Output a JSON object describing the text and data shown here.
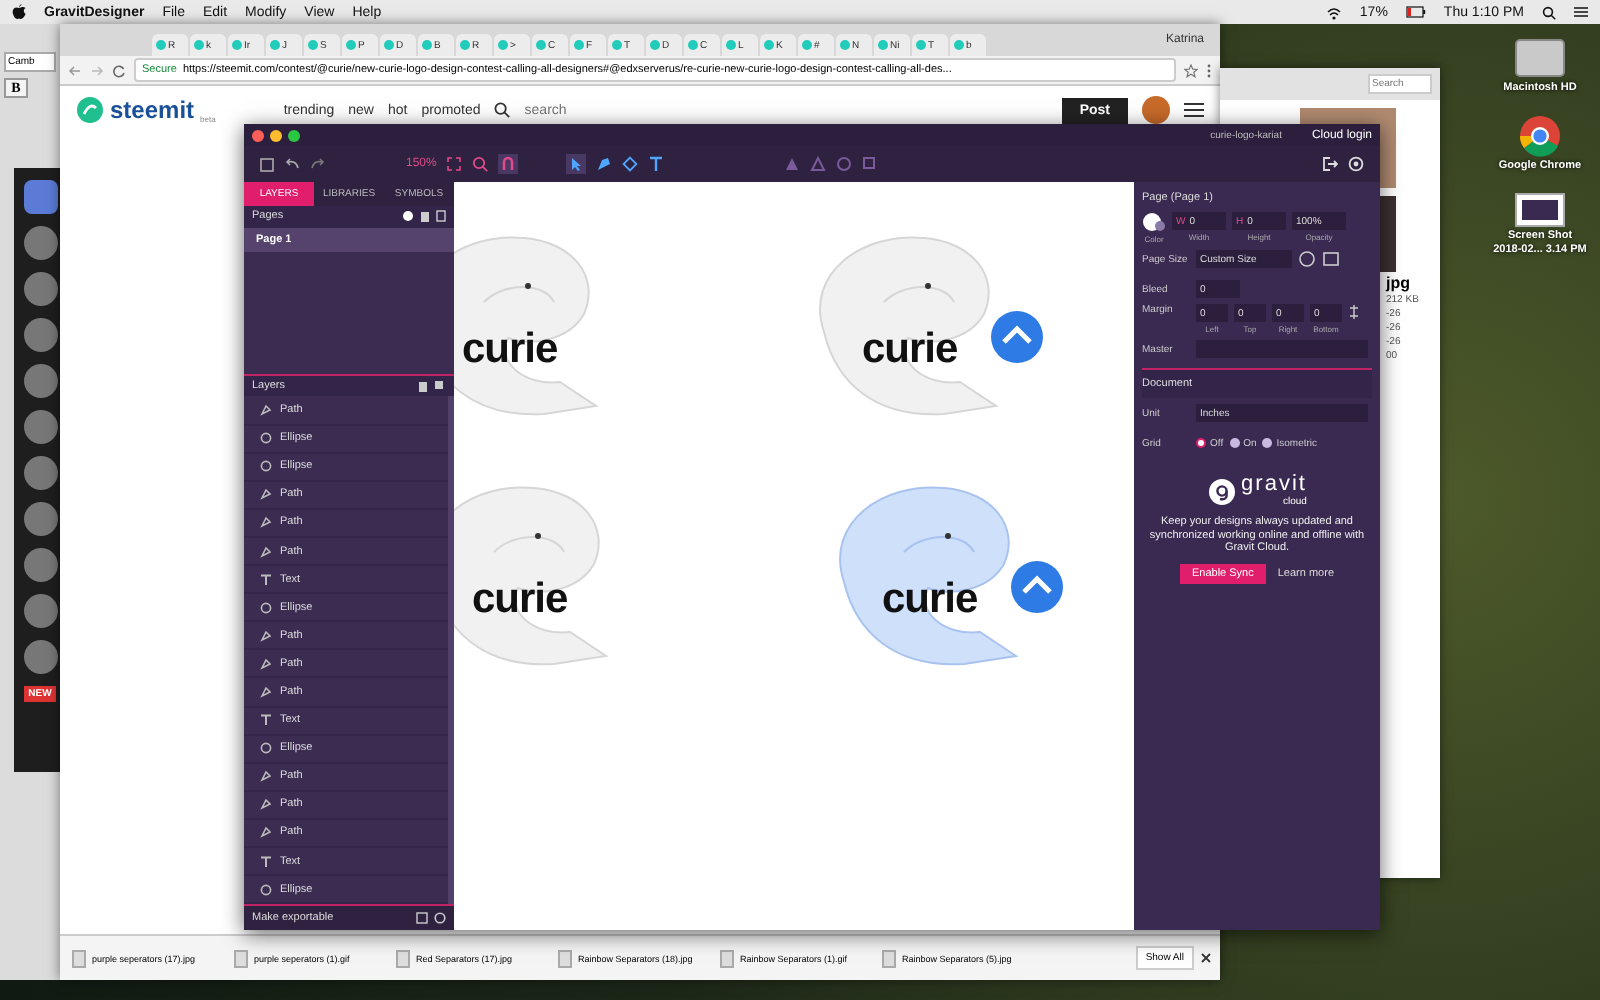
{
  "menubar": {
    "app": "GravitDesigner",
    "menus": [
      "File",
      "Edit",
      "Modify",
      "View",
      "Help"
    ],
    "battery": "17%",
    "clock": "Thu 1:10 PM"
  },
  "left_window": {
    "bold_button": "B",
    "font_field": "Camb"
  },
  "dock": {
    "new_badge": "NEW"
  },
  "browser": {
    "tabs": [
      {
        "label": "R"
      },
      {
        "label": "k"
      },
      {
        "label": "Ir"
      },
      {
        "label": "J"
      },
      {
        "label": "S"
      },
      {
        "label": "P"
      },
      {
        "label": "D"
      },
      {
        "label": "B"
      },
      {
        "label": "R"
      },
      {
        "label": ">"
      },
      {
        "label": "C"
      },
      {
        "label": "F"
      },
      {
        "label": "T"
      },
      {
        "label": "D"
      },
      {
        "label": "C"
      },
      {
        "label": "L"
      },
      {
        "label": "K"
      },
      {
        "label": "#"
      },
      {
        "label": "N"
      },
      {
        "label": "Ni"
      },
      {
        "label": "T"
      },
      {
        "label": "b"
      }
    ],
    "profile": "Katrina",
    "secure": "Secure",
    "url": "https://steemit.com/contest/@curie/new-curie-logo-design-contest-calling-all-designers#@edxserverus/re-curie-new-curie-logo-design-contest-calling-all-des...",
    "site": {
      "logo": "steemit",
      "tagline": "beta",
      "nav": [
        "trending",
        "new",
        "hot",
        "promoted"
      ],
      "search_placeholder": "search",
      "post": "Post"
    },
    "downloads": [
      "purple seperators (17).jpg",
      "purple seperators (1).gif",
      "Red Separators (17).jpg",
      "Rainbow Separators (18).jpg",
      "Rainbow Separators (1).gif",
      "Rainbow Separators (5).jpg"
    ],
    "show_all": "Show All"
  },
  "finder": {
    "search_placeholder": "Search",
    "file_name": "jpg",
    "size": "212 KB",
    "dates": [
      "-26",
      "-26",
      "-26",
      "00"
    ]
  },
  "desktop_icons": [
    {
      "kind": "drive",
      "lines": [
        "Macintosh HD"
      ]
    },
    {
      "kind": "app",
      "lines": [
        "Google Chrome"
      ]
    },
    {
      "kind": "screenshot",
      "lines": [
        "Screen Shot",
        "2018-02... 3.14 PM"
      ]
    }
  ],
  "gravit": {
    "document": "curie-logo-kariat",
    "cloud_login": "Cloud login",
    "zoom": "150%",
    "panel_tabs": [
      {
        "label": "LAYERS",
        "selected": true
      },
      {
        "label": "LIBRARIES",
        "selected": false
      },
      {
        "label": "SYMBOLS",
        "selected": false
      }
    ],
    "pages_label": "Pages",
    "pages": [
      {
        "name": "Page 1",
        "selected": true
      }
    ],
    "layers_label": "Layers",
    "layers": [
      {
        "kind": "path",
        "name": "Path"
      },
      {
        "kind": "ellipse",
        "name": "Ellipse"
      },
      {
        "kind": "ellipse",
        "name": "Ellipse"
      },
      {
        "kind": "path",
        "name": "Path"
      },
      {
        "kind": "path",
        "name": "Path"
      },
      {
        "kind": "path",
        "name": "Path"
      },
      {
        "kind": "text",
        "name": "Text"
      },
      {
        "kind": "ellipse",
        "name": "Ellipse"
      },
      {
        "kind": "path",
        "name": "Path"
      },
      {
        "kind": "path",
        "name": "Path"
      },
      {
        "kind": "path",
        "name": "Path"
      },
      {
        "kind": "text",
        "name": "Text"
      },
      {
        "kind": "ellipse",
        "name": "Ellipse"
      },
      {
        "kind": "path",
        "name": "Path"
      },
      {
        "kind": "path",
        "name": "Path"
      },
      {
        "kind": "path",
        "name": "Path"
      },
      {
        "kind": "text",
        "name": "Text"
      },
      {
        "kind": "ellipse",
        "name": "Ellipse"
      }
    ],
    "footer": "Make exportable",
    "canvas": {
      "logos": [
        {
          "text": "curie",
          "filled": false,
          "badge": false
        },
        {
          "text": "curie",
          "filled": false,
          "badge": true
        },
        {
          "text": "curie",
          "filled": false,
          "badge": false
        },
        {
          "text": "curie",
          "filled": true,
          "badge": true
        }
      ]
    },
    "inspector": {
      "title": "Page (Page 1)",
      "color_label": "Color",
      "size_fields": [
        {
          "prefix": "W",
          "value": "0",
          "label": "Width"
        },
        {
          "prefix": "H",
          "value": "0",
          "label": "Height"
        },
        {
          "value": "100%",
          "label": "Opacity"
        }
      ],
      "page_size": {
        "label": "Page Size",
        "value": "Custom Size"
      },
      "bleed": {
        "label": "Bleed",
        "value": "0"
      },
      "margin": {
        "label": "Margin",
        "fields": [
          {
            "value": "0",
            "label": "Left"
          },
          {
            "value": "0",
            "label": "Top"
          },
          {
            "value": "0",
            "label": "Right"
          },
          {
            "value": "0",
            "label": "Bottom"
          }
        ]
      },
      "master": {
        "label": "Master"
      },
      "document_title": "Document",
      "unit": {
        "label": "Unit",
        "value": "Inches"
      },
      "grid": {
        "label": "Grid",
        "options": [
          {
            "label": "Off",
            "selected": true
          },
          {
            "label": "On",
            "selected": false
          },
          {
            "label": "Isometric",
            "selected": false
          }
        ]
      },
      "cloud": {
        "brand": "gravit",
        "sub": "cloud",
        "message": "Keep your designs always updated and synchronized working online and offline with Gravit Cloud.",
        "button": "Enable Sync",
        "link": "Learn more"
      }
    }
  }
}
